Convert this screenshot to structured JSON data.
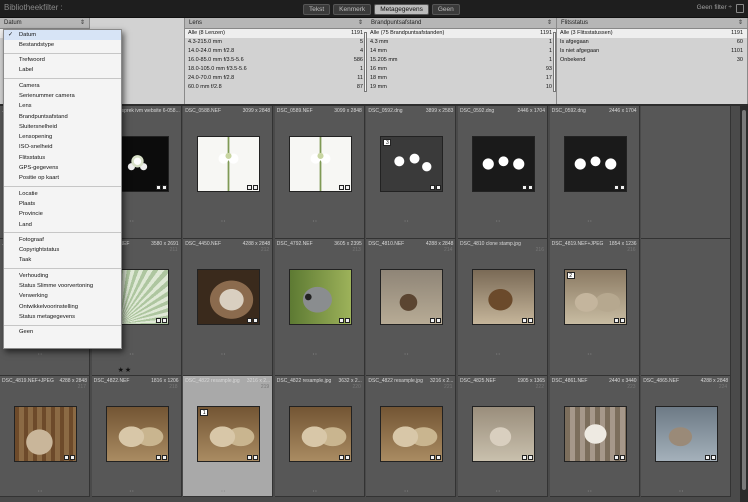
{
  "topbar": {
    "title": "Bibliotheekfilter :",
    "tabs": [
      "Tekst",
      "Kenmerk",
      "Metagegevens",
      "Geen"
    ],
    "active_tab": 2,
    "preset": "Geen filter ÷"
  },
  "filters": {
    "columns": [
      {
        "header": "Datum",
        "rows": [
          {
            "label": "Alle (9 datums)",
            "count": "1191"
          },
          {
            "label": "2008",
            "count": "12"
          },
          {
            "label": "2009",
            "count": "14"
          },
          {
            "label": "2010",
            "count": "75"
          },
          {
            "label": "2011",
            "count": "123"
          },
          {
            "label": "2012",
            "count": "1"
          },
          {
            "label": "2013",
            "count": "27"
          }
        ]
      },
      {
        "header": "Lens",
        "rows": [
          {
            "label": "Alle (8 Lenzen)",
            "count": "1191"
          },
          {
            "label": "4.3-215.0 mm",
            "count": "5"
          },
          {
            "label": "14.0-24.0 mm f/2.8",
            "count": "4"
          },
          {
            "label": "16.0-85.0 mm f/3.5-5.6",
            "count": "586"
          },
          {
            "label": "18.0-105.0 mm f/3.5-5.6",
            "count": "1"
          },
          {
            "label": "24.0-70.0 mm f/2.8",
            "count": "11"
          },
          {
            "label": "60.0 mm f/2.8",
            "count": "87"
          }
        ]
      },
      {
        "header": "Brandpuntsafstand",
        "rows": [
          {
            "label": "Alle (75 Brandpuntsafstanden)",
            "count": "1191"
          },
          {
            "label": "4.3 mm",
            "count": "1"
          },
          {
            "label": "14 mm",
            "count": "1"
          },
          {
            "label": "15.205 mm",
            "count": "1"
          },
          {
            "label": "16 mm",
            "count": "93"
          },
          {
            "label": "18 mm",
            "count": "17"
          },
          {
            "label": "19 mm",
            "count": "10"
          }
        ]
      },
      {
        "header": "Flitsstatus",
        "rows": [
          {
            "label": "Alle (3 Flitsstatussen)",
            "count": "1191"
          },
          {
            "label": "Is afgegaan",
            "count": "60"
          },
          {
            "label": "Is niet afgegaan",
            "count": "1101"
          },
          {
            "label": "Onbekend",
            "count": "30"
          }
        ]
      }
    ]
  },
  "dropdown": {
    "groups": [
      [
        "Datum",
        "Bestandstype"
      ],
      [
        "Trefwoord",
        "Label"
      ],
      [
        "Camera",
        "Serienummer camera",
        "Lens",
        "Brandpuntsafstand",
        "Sluitersnelheid",
        "Lensopening",
        "ISO-snelheid",
        "Flitsstatus",
        "GPS-gegevens",
        "Positie op kaart"
      ],
      [
        "Locatie",
        "Plaats",
        "Provincie",
        "Land"
      ],
      [
        "Fotograaf",
        "Copyrightstatus",
        "Taak"
      ],
      [
        "Verhouding",
        "Status Slimme voorvertoning",
        "Verwerking",
        "Ontwikkelvoorinstelling",
        "Status metagegevens"
      ],
      [
        "Geen"
      ]
    ],
    "selected": "Datum"
  },
  "grid": {
    "rows": [
      [
        {
          "name": "...F+JPEG",
          "dims": "4288 x 2848",
          "idx": "",
          "scene": "flower-dark-left"
        },
        {
          "name": "Naam kasgesprek ivm website 6-058...",
          "dims": "",
          "idx": "",
          "scene": "flower-dark"
        },
        {
          "name": "DSC_0588.NEF",
          "dims": "3099 x 2848",
          "idx": "",
          "scene": "flower-white"
        },
        {
          "name": "DSC_0589.NEF",
          "dims": "3099 x 2848",
          "idx": "",
          "scene": "flower-white"
        },
        {
          "name": "DSC_0592.dng",
          "dims": "3899 x 2583",
          "idx": "",
          "scene": "flower-grey",
          "num": "3"
        },
        {
          "name": "DSC_0592.dng",
          "dims": "2446 x 1704",
          "idx": "",
          "scene": "flower-dark2"
        },
        {
          "name": "DSC_0592.dng",
          "dims": "2446 x 1704",
          "idx": "",
          "scene": "flower-dark2"
        },
        {
          "name": "",
          "dims": "",
          "idx": "",
          "scene": "empty"
        }
      ],
      [
        {
          "name": "...NEF",
          "dims": "3580 x 2691",
          "idx": "210",
          "scene": "palm"
        },
        {
          "name": "DSC_0453.NEF",
          "dims": "3580 x 2691",
          "idx": "211",
          "scene": "palm"
        },
        {
          "name": "DSC_4450.NEF",
          "dims": "4288 x 2848",
          "idx": "212",
          "scene": "parrot-close"
        },
        {
          "name": "DSC_4792.NEF",
          "dims": "3605 x 2395",
          "idx": "213",
          "scene": "parrot"
        },
        {
          "name": "DSC_4810.NEF",
          "dims": "4288 x 2848",
          "idx": "214",
          "scene": "lynx-walk"
        },
        {
          "name": "DSC_4810 clone stamp.jpg",
          "dims": "",
          "idx": "216",
          "scene": "lynx-stand"
        },
        {
          "name": "DSC_4819.NEF+JPEG",
          "dims": "1854 x 1236",
          "idx": "216",
          "scene": "lynx-rest",
          "num": "2"
        },
        {
          "name": "",
          "dims": "",
          "idx": "",
          "scene": "empty"
        }
      ],
      [
        {
          "name": "DSC_4819.NEF+JPEG",
          "dims": "4288 x 2848",
          "idx": "217",
          "scene": "lynx-rest2"
        },
        {
          "name": "DSC_4822.NEF",
          "dims": "1816 x 1206",
          "idx": "218",
          "scene": "lynx-face"
        },
        {
          "name": "DSC_4822 resample.jpg",
          "dims": "3216 x 2...",
          "idx": "219",
          "scene": "lynx-face",
          "num": "1"
        },
        {
          "name": "DSC_4822 resample.jpg",
          "dims": "3632 x 2...",
          "idx": "220",
          "scene": "lynx-face"
        },
        {
          "name": "DSC_4822 resample.jpg",
          "dims": "3216 x 2...",
          "idx": "221",
          "scene": "lynx-face"
        },
        {
          "name": "DSC_4825.NEF",
          "dims": "1905 x 1365",
          "idx": "222",
          "scene": "lynx-sit"
        },
        {
          "name": "DSC_4861.NEF",
          "dims": "2440 x 3440",
          "idx": "223",
          "scene": "lynx-white"
        },
        {
          "name": "DSC_4865.NEF",
          "dims": "4288 x 2848",
          "idx": "224",
          "scene": "wolf"
        }
      ]
    ],
    "stars": "★★"
  }
}
